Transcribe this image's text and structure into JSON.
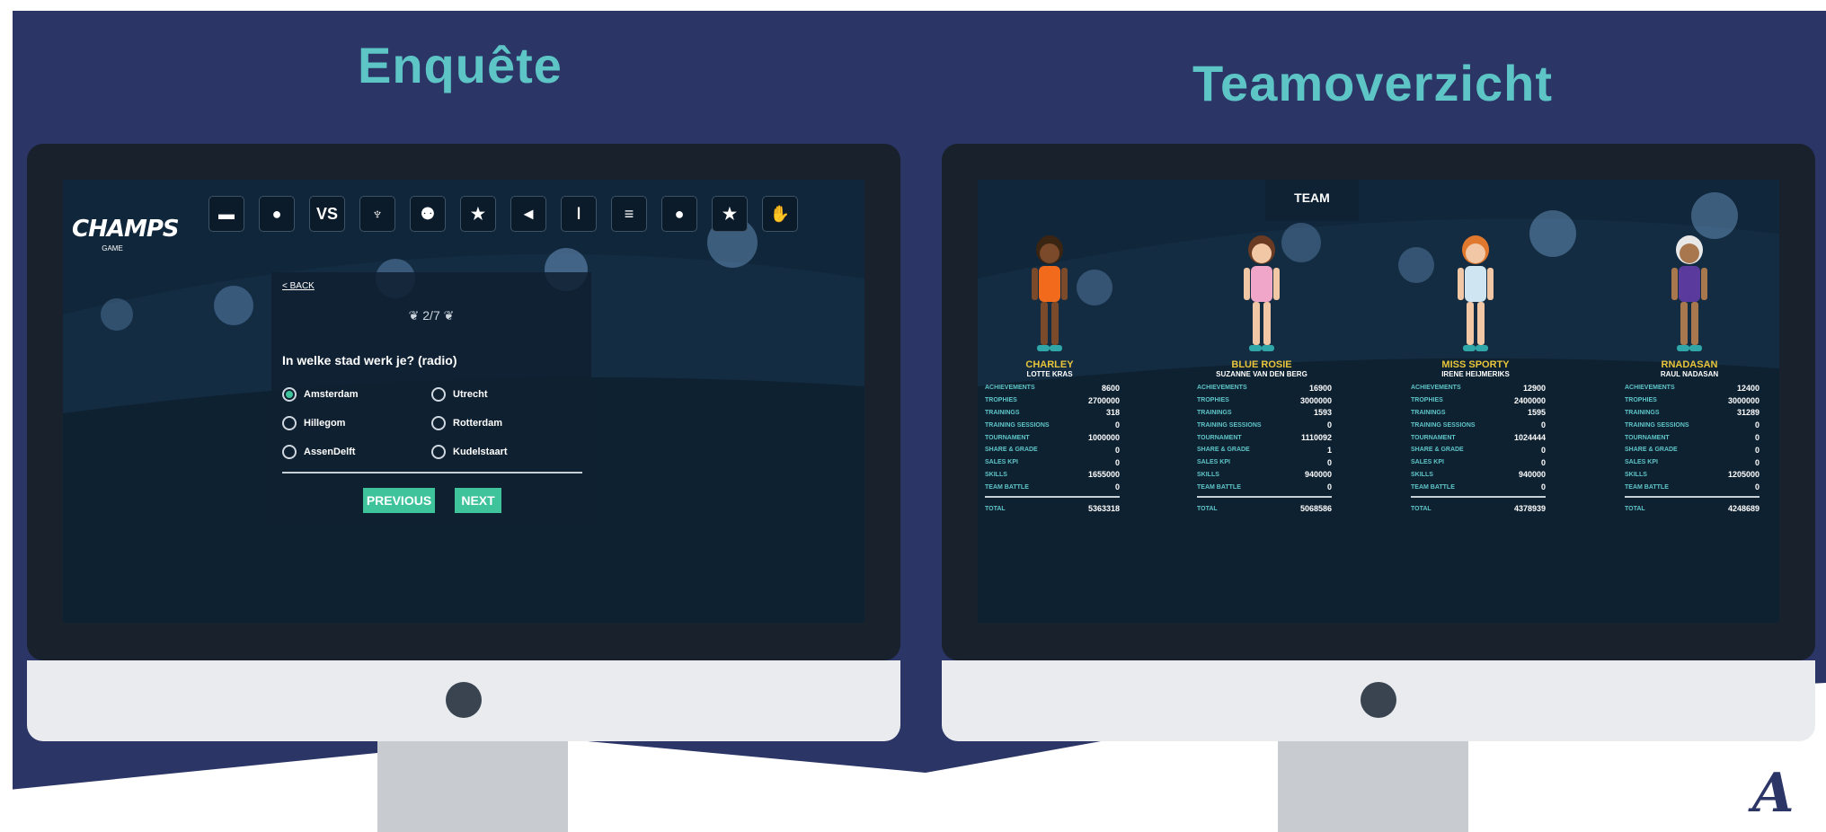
{
  "left": {
    "heading": "Enquête",
    "logo": {
      "name": "CHAMPS",
      "sub": "GAME"
    },
    "nav_icons": [
      "stadium-icon",
      "globe-icon",
      "vs-icon",
      "trophy-icon",
      "team-icon",
      "star-icon",
      "megaphone-icon",
      "torch-icon",
      "crowd-icon",
      "bulb-icon",
      "star-icon",
      "hand-icon"
    ],
    "nav_vs_label": "VS",
    "survey": {
      "back_label": "< BACK",
      "progress": "2/7",
      "question": "In welke stad werk je? (radio)",
      "options": [
        {
          "label": "Amsterdam",
          "selected": true
        },
        {
          "label": "Utrecht",
          "selected": false
        },
        {
          "label": "Hillegom",
          "selected": false
        },
        {
          "label": "Rotterdam",
          "selected": false
        },
        {
          "label": "AssenDelft",
          "selected": false
        },
        {
          "label": "Kudelstaart",
          "selected": false
        }
      ],
      "previous_label": "PREVIOUS",
      "next_label": "NEXT"
    }
  },
  "right": {
    "heading": "Teamoverzicht",
    "tab_label": "TEAM",
    "stat_keys": [
      "ACHIEVEMENTS",
      "TROPHIES",
      "TRAININGS",
      "TRAINING SESSIONS",
      "TOURNAMENT",
      "SHARE & GRADE",
      "SALES KPI",
      "SKILLS",
      "TEAM BATTLE"
    ],
    "total_label": "TOTAL",
    "players": [
      {
        "nick": "CHARLEY",
        "real": "LOTTE KRAS",
        "values": [
          "8600",
          "2700000",
          "318",
          "0",
          "1000000",
          "0",
          "0",
          "1655000",
          "0"
        ],
        "total": "5363318",
        "shirt": "#f26b1d",
        "skin": "#7a4a2a",
        "hair": "#3a2412"
      },
      {
        "nick": "BLUE ROSIE",
        "real": "SUZANNE VAN DEN BERG",
        "values": [
          "16900",
          "3000000",
          "1593",
          "0",
          "1110092",
          "1",
          "0",
          "940000",
          "0"
        ],
        "total": "5068586",
        "shirt": "#f0a6c8",
        "skin": "#f1c7a5",
        "hair": "#6b3a22"
      },
      {
        "nick": "MISS SPORTY",
        "real": "IRENE HEIJMERIKS",
        "values": [
          "12900",
          "2400000",
          "1595",
          "0",
          "1024444",
          "0",
          "0",
          "940000",
          "0"
        ],
        "total": "4378939",
        "shirt": "#cfe6f2",
        "skin": "#f1c7a5",
        "hair": "#e0782e"
      },
      {
        "nick": "RNADASAN",
        "real": "RAUL NADASAN",
        "values": [
          "12400",
          "3000000",
          "31289",
          "0",
          "0",
          "0",
          "0",
          "1205000",
          "0"
        ],
        "total": "4248689",
        "shirt": "#5a3a9c",
        "skin": "#a8774e",
        "hair": "#e8e8e8"
      }
    ]
  },
  "brand_mark": "A"
}
